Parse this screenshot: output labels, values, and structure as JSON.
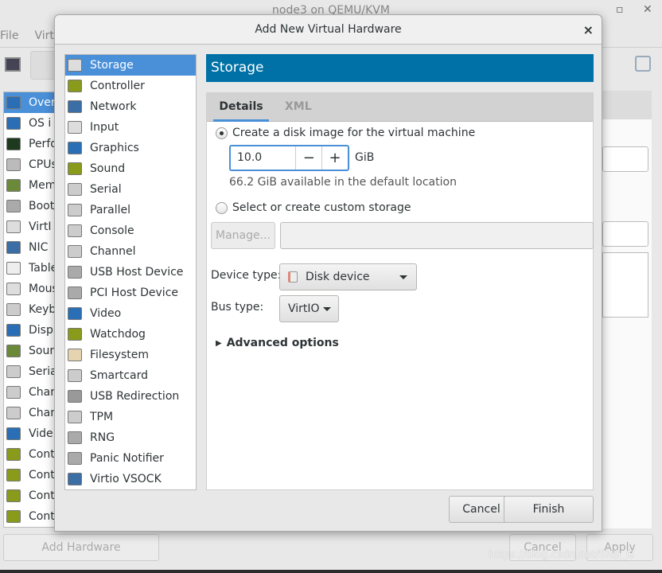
{
  "bg_window": {
    "title": "node3 on QEMU/KVM",
    "menu": [
      "File",
      "Virtu"
    ],
    "sidebar": [
      {
        "label": "Over",
        "icon": "monitor-icon",
        "selected": true
      },
      {
        "label": "OS i",
        "icon": "monitor-icon"
      },
      {
        "label": "Perfo",
        "icon": "performance-icon"
      },
      {
        "label": "CPUs",
        "icon": "cpu-icon"
      },
      {
        "label": "Mem",
        "icon": "memory-icon"
      },
      {
        "label": "Boot",
        "icon": "gears-icon"
      },
      {
        "label": "VirtI",
        "icon": "disk-icon"
      },
      {
        "label": "NIC",
        "icon": "network-icon"
      },
      {
        "label": "Table",
        "icon": "tablet-icon"
      },
      {
        "label": "Mous",
        "icon": "mouse-icon"
      },
      {
        "label": "Keyb",
        "icon": "keyboard-icon"
      },
      {
        "label": "Displ",
        "icon": "monitor-icon"
      },
      {
        "label": "Soun",
        "icon": "sound-icon"
      },
      {
        "label": "Seria",
        "icon": "serial-icon"
      },
      {
        "label": "Chan",
        "icon": "serial-icon"
      },
      {
        "label": "Chan",
        "icon": "serial-icon"
      },
      {
        "label": "Vide",
        "icon": "monitor-icon"
      },
      {
        "label": "Cont",
        "icon": "controller-icon"
      },
      {
        "label": "Cont",
        "icon": "controller-icon"
      },
      {
        "label": "Cont",
        "icon": "controller-icon"
      },
      {
        "label": "Cont",
        "icon": "controller-icon"
      }
    ],
    "add_hardware": "Add Hardware",
    "cancel": "Cancel",
    "apply": "Apply"
  },
  "dialog": {
    "title": "Add New Virtual Hardware",
    "hardware": [
      {
        "label": "Storage",
        "icon": "disk-icon",
        "selected": true
      },
      {
        "label": "Controller",
        "icon": "controller-icon"
      },
      {
        "label": "Network",
        "icon": "network-icon"
      },
      {
        "label": "Input",
        "icon": "mouse-icon"
      },
      {
        "label": "Graphics",
        "icon": "monitor-icon"
      },
      {
        "label": "Sound",
        "icon": "sound-card-icon"
      },
      {
        "label": "Serial",
        "icon": "port-icon"
      },
      {
        "label": "Parallel",
        "icon": "port-icon"
      },
      {
        "label": "Console",
        "icon": "port-icon"
      },
      {
        "label": "Channel",
        "icon": "port-icon"
      },
      {
        "label": "USB Host Device",
        "icon": "gears-icon"
      },
      {
        "label": "PCI Host Device",
        "icon": "gears-icon"
      },
      {
        "label": "Video",
        "icon": "monitor-icon"
      },
      {
        "label": "Watchdog",
        "icon": "controller-icon"
      },
      {
        "label": "Filesystem",
        "icon": "folder-icon"
      },
      {
        "label": "Smartcard",
        "icon": "smartcard-icon"
      },
      {
        "label": "USB Redirection",
        "icon": "usb-icon"
      },
      {
        "label": "TPM",
        "icon": "chip-icon"
      },
      {
        "label": "RNG",
        "icon": "gears-icon"
      },
      {
        "label": "Panic Notifier",
        "icon": "gears-icon"
      },
      {
        "label": "Virtio VSOCK",
        "icon": "network-icon"
      }
    ],
    "header": "Storage",
    "tabs": [
      {
        "label": "Details",
        "active": true
      },
      {
        "label": "XML"
      }
    ],
    "create_disk_label": "Create a disk image for the virtual machine",
    "size_value": "10.0",
    "size_unit": "GiB",
    "available": "66.2 GiB available in the default location",
    "custom_label": "Select or create custom storage",
    "manage": "Manage...",
    "custom_path": "",
    "device_type_label": "Device type:",
    "device_type": "Disk device",
    "bus_type_label": "Bus type:",
    "bus_type": "VirtIO",
    "advanced": "Advanced options",
    "cancel": "Cancel",
    "finish": "Finish"
  },
  "watermark": "https://blog.csdn.net/Shiji_G",
  "colors": {
    "selection": "#4a90d9",
    "header": "#0071a6"
  }
}
